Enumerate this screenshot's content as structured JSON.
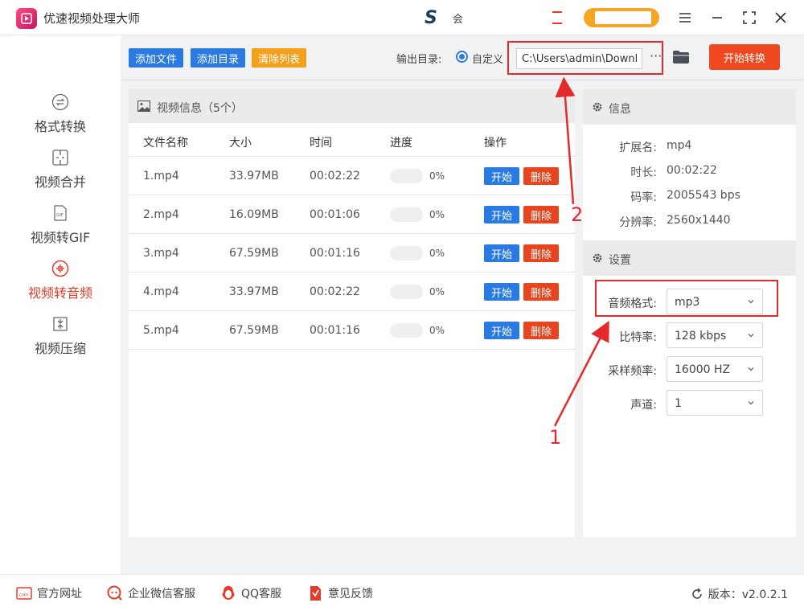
{
  "app": {
    "title": "优速视频处理大师",
    "center_logo": "S",
    "center_text": "会"
  },
  "sidebar": {
    "items": [
      {
        "label": "格式转换",
        "icon": "swap-circle-icon",
        "active": false
      },
      {
        "label": "视频合并",
        "icon": "merge-icon",
        "active": false
      },
      {
        "label": "视频转GIF",
        "icon": "gif-icon",
        "active": false
      },
      {
        "label": "视频转音频",
        "icon": "audio-wave-icon",
        "active": true
      },
      {
        "label": "视频压缩",
        "icon": "compress-icon",
        "active": false
      }
    ]
  },
  "toolbar": {
    "add_file": "添加文件",
    "add_dir": "添加目录",
    "clear_list": "清除列表",
    "output_label": "输出目录:",
    "custom_label": "自定义",
    "output_path": "C:\\Users\\admin\\Downlo",
    "more": "···",
    "start_convert": "开始转换"
  },
  "video_panel": {
    "title": "视频信息（5个）",
    "columns": [
      "文件名称",
      "大小",
      "时间",
      "进度",
      "操作"
    ],
    "rows": [
      {
        "name": "1.mp4",
        "size": "33.97MB",
        "time": "00:02:22",
        "progress": 0,
        "progress_label": "0%"
      },
      {
        "name": "2.mp4",
        "size": "16.09MB",
        "time": "00:01:06",
        "progress": 0,
        "progress_label": "0%"
      },
      {
        "name": "3.mp4",
        "size": "67.59MB",
        "time": "00:01:16",
        "progress": 0,
        "progress_label": "0%"
      },
      {
        "name": "4.mp4",
        "size": "33.97MB",
        "time": "00:02:22",
        "progress": 0,
        "progress_label": "0%"
      },
      {
        "name": "5.mp4",
        "size": "67.59MB",
        "time": "00:01:16",
        "progress": 0,
        "progress_label": "0%"
      }
    ],
    "start_label": "开始",
    "delete_label": "删除"
  },
  "info": {
    "title": "信息",
    "ext_key": "扩展名:",
    "ext_val": "mp4",
    "dur_key": "时长:",
    "dur_val": "00:02:22",
    "bitrate_key": "码率:",
    "bitrate_val": "2005543 bps",
    "res_key": "分辨率:",
    "res_val": "2560x1440"
  },
  "settings": {
    "title": "设置",
    "format_label": "音频格式:",
    "format_val": "mp3",
    "bitrate_label": "比特率:",
    "bitrate_val": "128 kbps",
    "sample_label": "采样频率:",
    "sample_val": "16000 HZ",
    "channel_label": "声道:",
    "channel_val": "1"
  },
  "annotations": {
    "num1": "1",
    "num2": "2"
  },
  "footer": {
    "website": "官方网址",
    "wechat": "企业微信客服",
    "qq": "QQ客服",
    "feedback": "意见反馈",
    "version": "版本：v2.0.2.1"
  },
  "colors": {
    "accent_blue": "#2a7ae2",
    "accent_red": "#f0481f",
    "annotation_red": "#e42b2b",
    "clear_orange": "#f5a01a"
  }
}
